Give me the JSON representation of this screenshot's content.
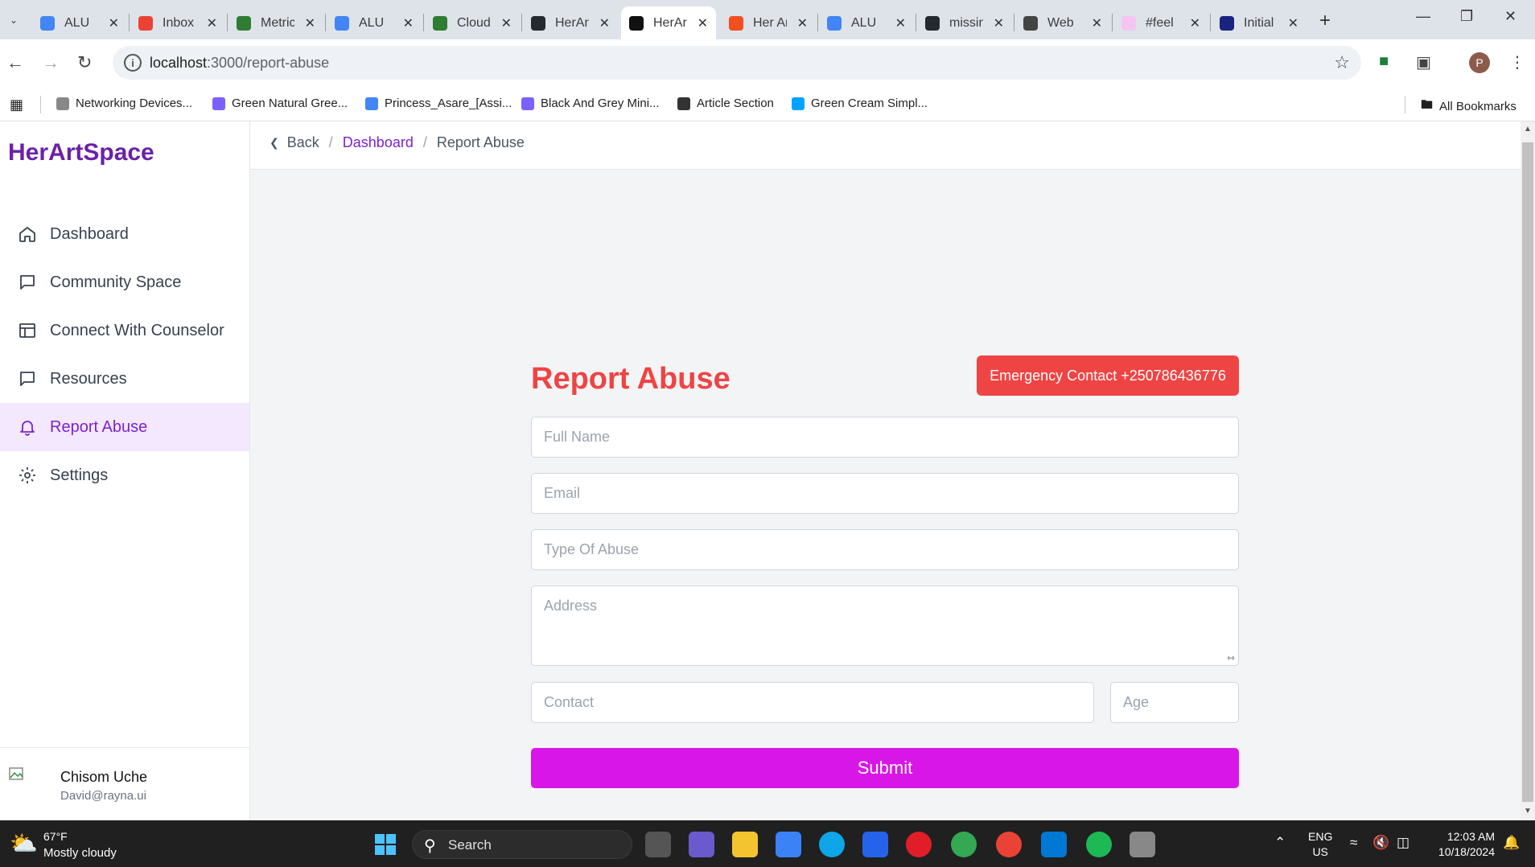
{
  "browser": {
    "tabs": [
      {
        "title": "ALU",
        "color": "#4285f4"
      },
      {
        "title": "Inbox",
        "color": "#ea4335"
      },
      {
        "title": "Metrics",
        "color": "#2e7d32"
      },
      {
        "title": "ALU",
        "color": "#4285f4"
      },
      {
        "title": "Cloud",
        "color": "#2e7d32"
      },
      {
        "title": "HerArtSpace",
        "color": "#24292f"
      },
      {
        "title": "HerArtSpace",
        "color": "#111111"
      },
      {
        "title": "Her Art",
        "color": "#f24e1e"
      },
      {
        "title": "ALU",
        "color": "#4285f4"
      },
      {
        "title": "missing",
        "color": "#24292f"
      },
      {
        "title": "Web",
        "color": "#444444"
      },
      {
        "title": "#feel",
        "color": "#f3c5f0"
      },
      {
        "title": "Initial",
        "color": "#1a237e"
      }
    ],
    "url_host": "localhost",
    "url_path": ":3000/report-abuse",
    "bookmarks": [
      {
        "label": "Networking Devices...",
        "color": "#888888"
      },
      {
        "label": "Green Natural Gree...",
        "color": "#7b61ff"
      },
      {
        "label": "Princess_Asare_[Assi...",
        "color": "#4285f4"
      },
      {
        "label": "Black And Grey Mini...",
        "color": "#7b61ff"
      },
      {
        "label": "Article Section",
        "color": "#333333"
      },
      {
        "label": "Green Cream Simpl...",
        "color": "#00a3ff"
      }
    ],
    "all_bookmarks": "All Bookmarks",
    "profile_initial": "P"
  },
  "sidebar": {
    "brand": "HerArtSpace",
    "items": [
      {
        "label": "Dashboard",
        "icon": "home-icon"
      },
      {
        "label": "Community Space",
        "icon": "chat-icon"
      },
      {
        "label": "Connect With Counselor",
        "icon": "layout-icon"
      },
      {
        "label": "Resources",
        "icon": "chat-icon"
      },
      {
        "label": "Report Abuse",
        "icon": "bell-icon",
        "active": true
      },
      {
        "label": "Settings",
        "icon": "gear-icon"
      }
    ],
    "user": {
      "name": "Chisom Uche",
      "email": "David@rayna.ui"
    }
  },
  "breadcrumb": {
    "back": "Back",
    "dashboard": "Dashboard",
    "current": "Report Abuse"
  },
  "form": {
    "title": "Report Abuse",
    "emergency": "Emergency Contact +250786436776",
    "full_name_ph": "Full Name",
    "email_ph": "Email",
    "type_ph": "Type Of Abuse",
    "address_ph": "Address",
    "contact_ph": "Contact",
    "age_ph": "Age",
    "submit": "Submit"
  },
  "colors": {
    "brand": "#6b21a8",
    "accent": "#7e22ce",
    "danger": "#ef4444",
    "submit": "#d916e8"
  },
  "taskbar": {
    "temp": "67°F",
    "weather": "Mostly cloudy",
    "search": "Search",
    "lang_1": "ENG",
    "lang_2": "US",
    "time": "12:03 AM",
    "date": "10/18/2024"
  }
}
